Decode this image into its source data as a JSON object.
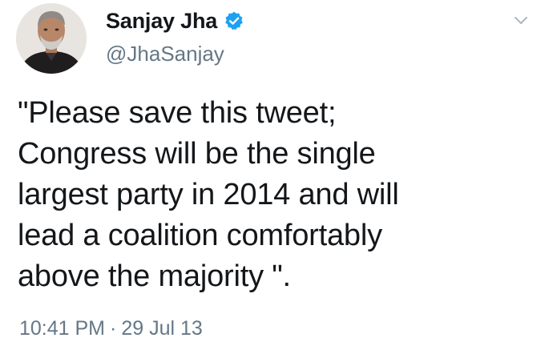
{
  "user": {
    "display_name": "Sanjay Jha",
    "handle": "@JhaSanjay",
    "verified": true
  },
  "icons": {
    "verified": "verified-badge-icon",
    "menu": "chevron-down-icon",
    "avatar": "profile-photo"
  },
  "colors": {
    "verified_blue": "#1da1f2",
    "secondary_text": "#657786",
    "primary_text": "#14171a"
  },
  "tweet": {
    "text": "\"Please save this tweet;\nCongress will be the single\nlargest party in 2014 and will\nlead a coalition comfortably\nabove the majority \".",
    "time": "10:41 PM",
    "separator": "·",
    "date": "29 Jul 13"
  }
}
